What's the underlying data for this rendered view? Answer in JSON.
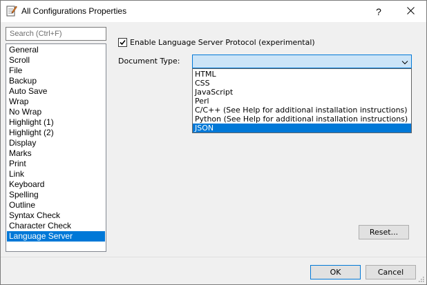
{
  "window": {
    "title": "All Configurations Properties",
    "help_label": "?",
    "close_label": "✕"
  },
  "search": {
    "placeholder": "Search (Ctrl+F)"
  },
  "categories": [
    "General",
    "Scroll",
    "File",
    "Backup",
    "Auto Save",
    "Wrap",
    "No Wrap",
    "Highlight (1)",
    "Highlight (2)",
    "Display",
    "Marks",
    "Print",
    "Link",
    "Keyboard",
    "Spelling",
    "Outline",
    "Syntax Check",
    "Character Check",
    "Language Server"
  ],
  "selected_category": "Language Server",
  "lsp": {
    "enable_label": "Enable Language Server Protocol (experimental)",
    "enabled": true,
    "document_type_label": "Document Type:",
    "document_type_value": "",
    "options": [
      "HTML",
      "CSS",
      "JavaScript",
      "Perl",
      "C/C++ (See Help for additional installation instructions)",
      "Python (See Help for additional installation instructions)",
      "JSON"
    ],
    "highlighted_option": "JSON"
  },
  "buttons": {
    "reset": "Reset...",
    "ok": "OK",
    "cancel": "Cancel"
  },
  "colors": {
    "accent": "#0078d7",
    "selection_bg": "#0078d7",
    "dropdown_bg": "#cce4f7"
  }
}
